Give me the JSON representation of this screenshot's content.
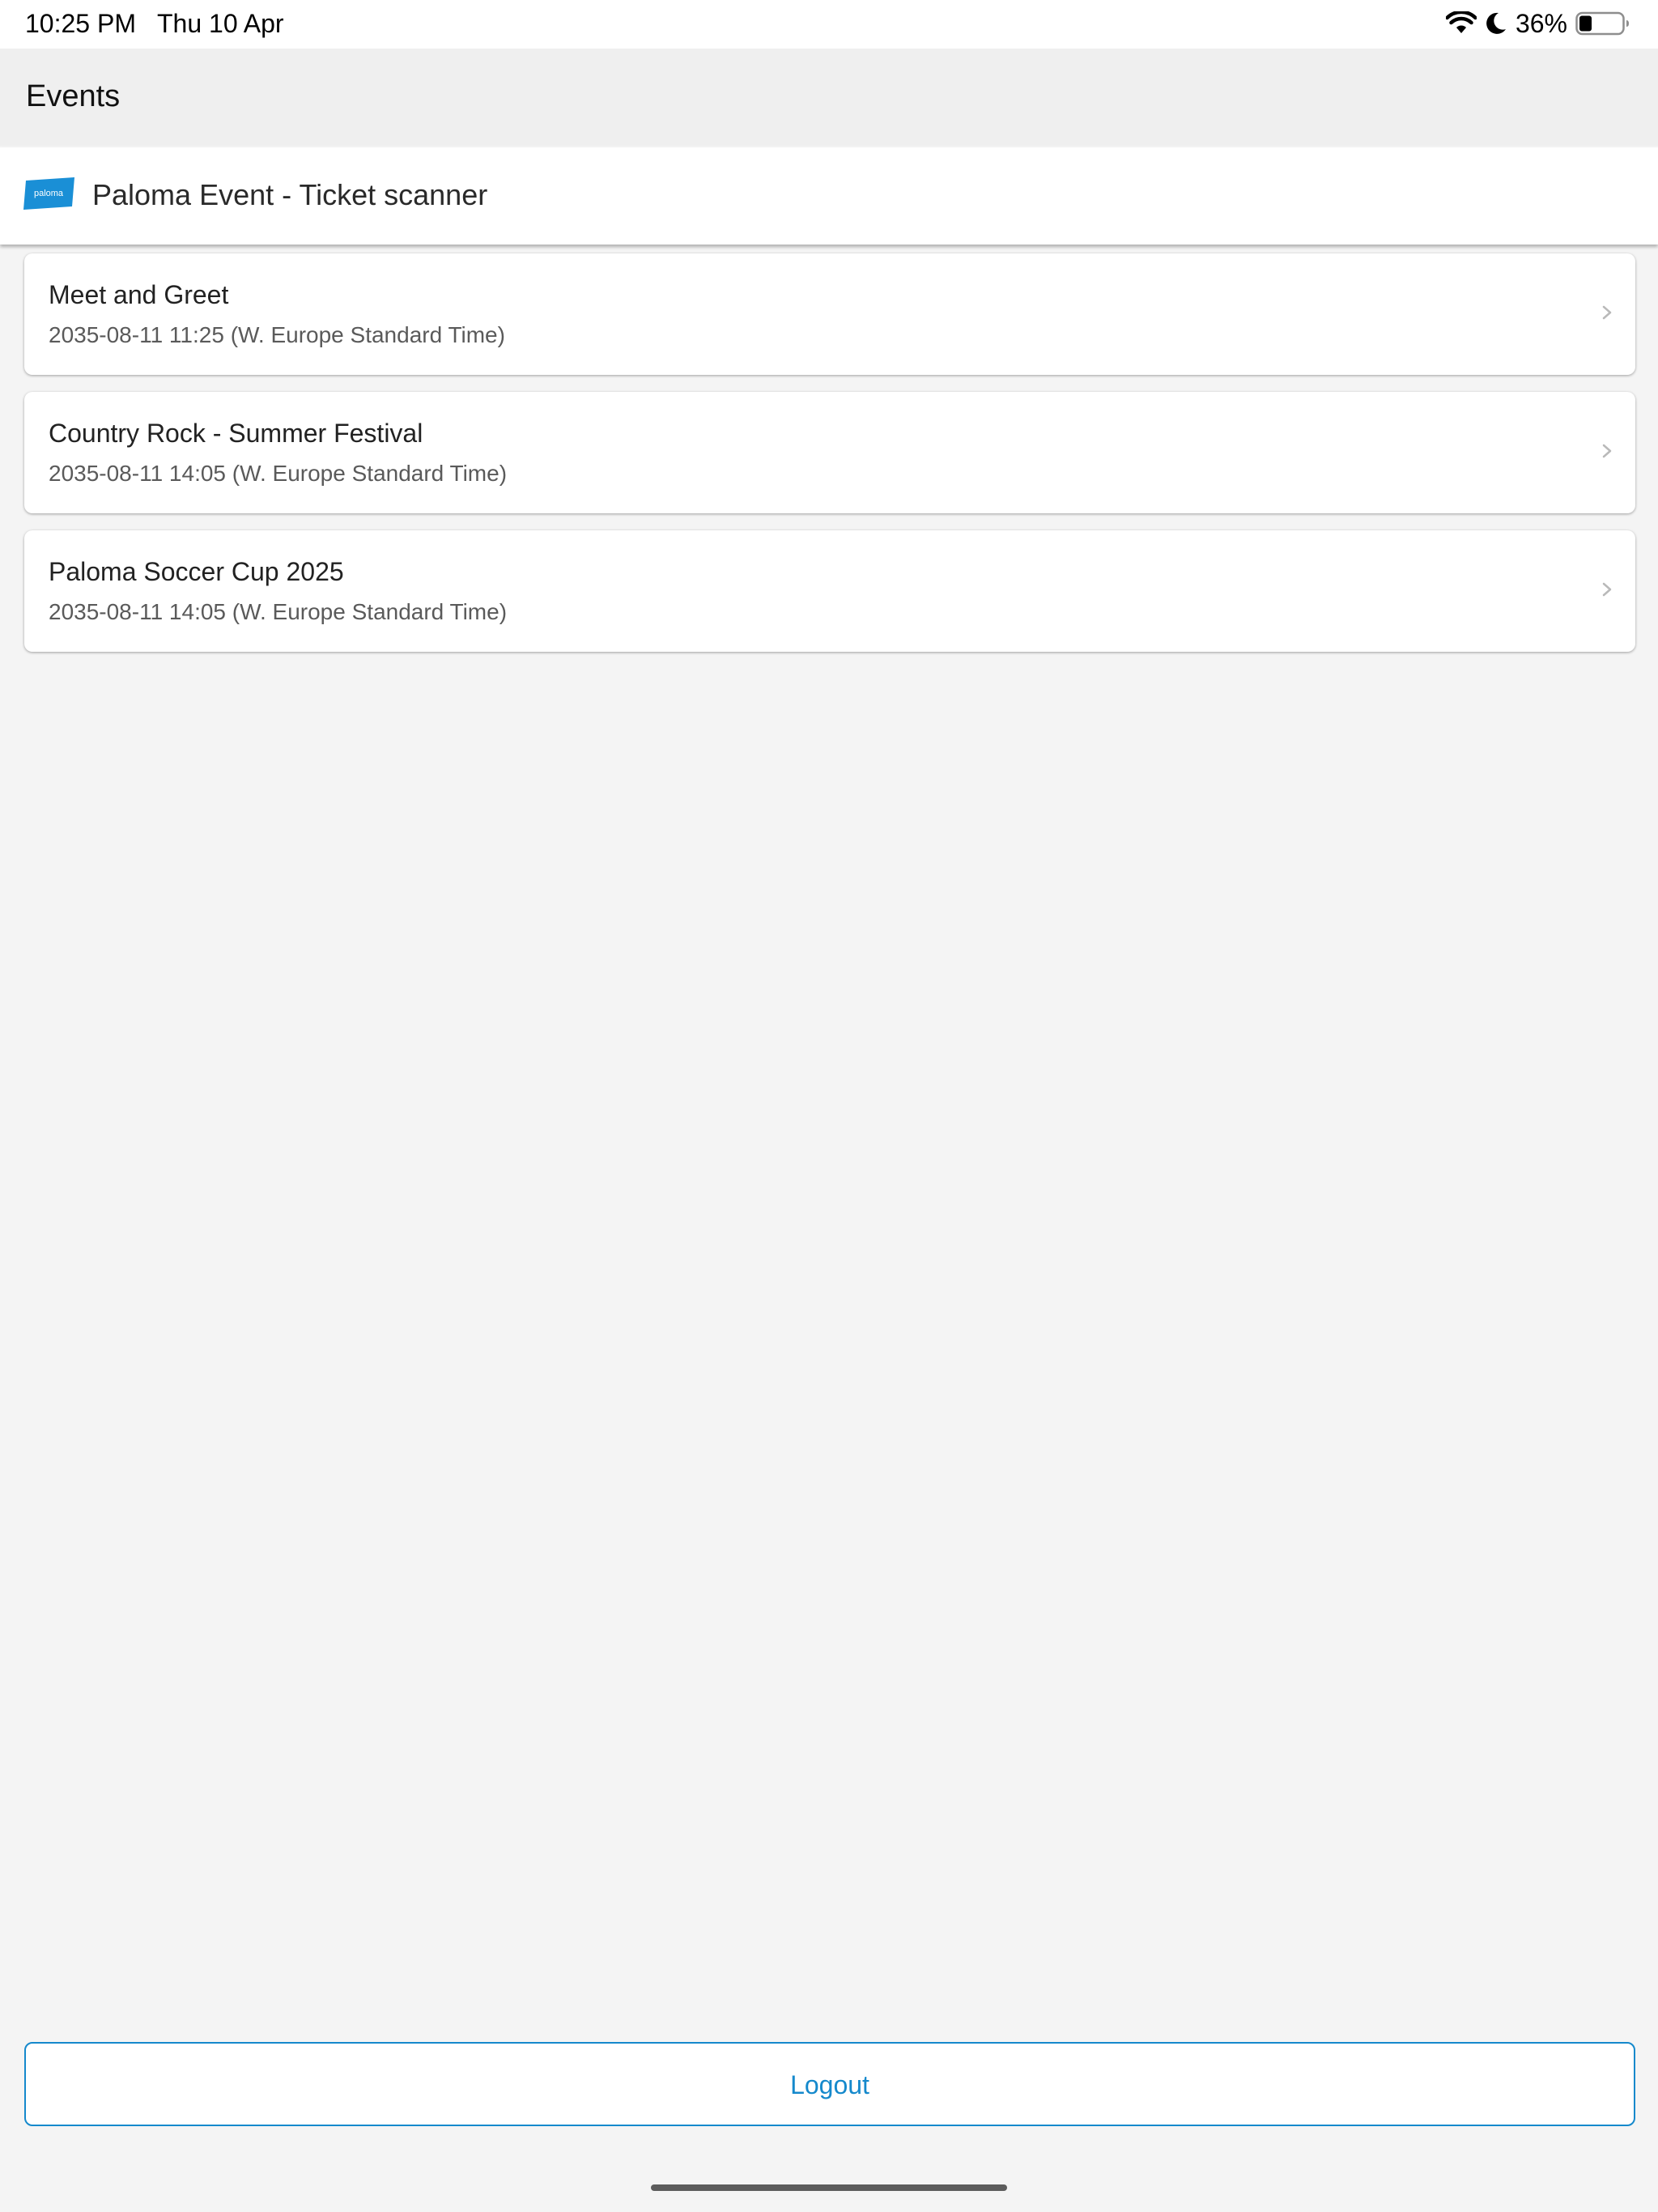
{
  "status_bar": {
    "time": "10:25 PM",
    "date": "Thu 10 Apr",
    "battery_percent": "36%",
    "battery_level": 0.36,
    "icons": [
      "wifi-icon",
      "do-not-disturb-moon-icon",
      "battery-icon"
    ]
  },
  "header": {
    "title": "Events"
  },
  "app_bar": {
    "logo_text": "paloma",
    "title": "Paloma Event - Ticket scanner"
  },
  "events": [
    {
      "name": "Meet and Greet",
      "datetime": "2035-08-11 11:25 (W. Europe Standard Time)"
    },
    {
      "name": "Country Rock - Summer Festival",
      "datetime": "2035-08-11 14:05 (W. Europe Standard Time)"
    },
    {
      "name": "Paloma Soccer Cup 2025",
      "datetime": "2035-08-11 14:05 (W. Europe Standard Time)"
    }
  ],
  "logout": {
    "label": "Logout"
  },
  "colors": {
    "accent": "#1589cc",
    "background": "#f4f4f4",
    "card": "#ffffff"
  }
}
